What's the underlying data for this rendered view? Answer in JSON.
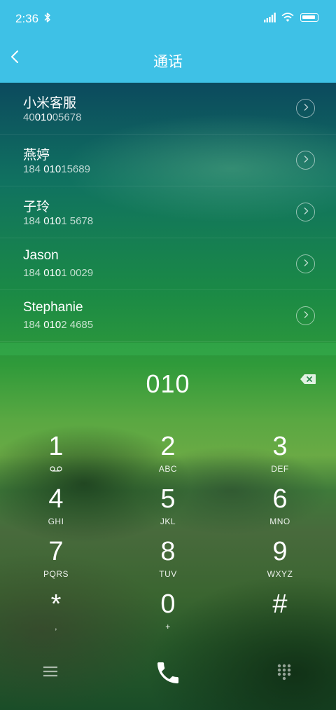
{
  "status": {
    "time": "2:36"
  },
  "header": {
    "title": "通话"
  },
  "contacts": [
    {
      "name": "小米客服",
      "num_pre": "40",
      "num_hl": "010",
      "num_post": "05678"
    },
    {
      "name": "燕婷",
      "num_pre": "184 ",
      "num_hl": "010",
      "num_post": "15689"
    },
    {
      "name": "子玲",
      "num_pre": "184 ",
      "num_hl": "010",
      "num_post": "1 5678"
    },
    {
      "name": "Jason",
      "num_pre": "184 ",
      "num_hl": "010",
      "num_post": "1 0029"
    },
    {
      "name": "Stephanie",
      "num_pre": "184 ",
      "num_hl": "010",
      "num_post": "2 4685"
    }
  ],
  "dialer": {
    "number": "010",
    "keys": [
      {
        "digit": "1",
        "letters": ""
      },
      {
        "digit": "2",
        "letters": "ABC"
      },
      {
        "digit": "3",
        "letters": "DEF"
      },
      {
        "digit": "4",
        "letters": "GHI"
      },
      {
        "digit": "5",
        "letters": "JKL"
      },
      {
        "digit": "6",
        "letters": "MNO"
      },
      {
        "digit": "7",
        "letters": "PQRS"
      },
      {
        "digit": "8",
        "letters": "TUV"
      },
      {
        "digit": "9",
        "letters": "WXYZ"
      },
      {
        "digit": "*",
        "letters": ","
      },
      {
        "digit": "0",
        "letters": "+"
      },
      {
        "digit": "#",
        "letters": ""
      }
    ]
  },
  "icons": {
    "bluetooth": "bluetooth-icon",
    "signal": "signal-icon",
    "wifi": "wifi-icon",
    "battery": "battery-icon",
    "back": "back-arrow-icon",
    "chevron": "chevron-right-icon",
    "backspace": "backspace-icon",
    "voicemail": "voicemail-icon",
    "menu": "menu-icon",
    "call": "phone-icon",
    "keypad": "keypad-icon"
  },
  "colors": {
    "accent": "#3ec1e6"
  }
}
